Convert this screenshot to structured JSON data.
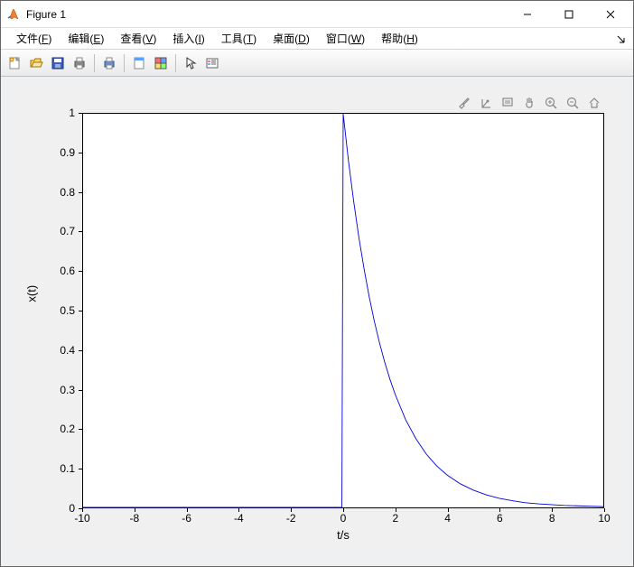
{
  "window": {
    "title": "Figure 1",
    "min_tip": "Minimize",
    "max_tip": "Maximize",
    "close_tip": "Close"
  },
  "menu": {
    "file": {
      "label": "文件",
      "hotkey": "F"
    },
    "edit": {
      "label": "编辑",
      "hotkey": "E"
    },
    "view": {
      "label": "查看",
      "hotkey": "V"
    },
    "insert": {
      "label": "插入",
      "hotkey": "I"
    },
    "tools": {
      "label": "工具",
      "hotkey": "T"
    },
    "desktop": {
      "label": "桌面",
      "hotkey": "D"
    },
    "windowm": {
      "label": "窗口",
      "hotkey": "W"
    },
    "help": {
      "label": "帮助",
      "hotkey": "H"
    }
  },
  "toolbar": {
    "new_tip": "New Figure",
    "open_tip": "Open",
    "save_tip": "Save",
    "print_tip": "Print",
    "printpreview_tip": "Print Preview",
    "link_tip": "Link Plot",
    "colorbar_tip": "Insert Colorbar",
    "arrow_tip": "Edit Plot",
    "legend_tip": "Insert Legend"
  },
  "axes_tools": {
    "brush": "Brush",
    "rotate": "Rotate 3D",
    "datatips": "Data Tips",
    "pan": "Pan",
    "zoomin": "Zoom In",
    "zoomout": "Zoom Out",
    "home": "Restore View"
  },
  "chart_data": {
    "type": "line",
    "xlabel": "t/s",
    "ylabel": "x(t)",
    "xlim": [
      -10,
      10
    ],
    "ylim": [
      0,
      1
    ],
    "xticks": [
      -10,
      -8,
      -6,
      -4,
      -2,
      0,
      2,
      4,
      6,
      8,
      10
    ],
    "yticks": [
      0,
      0.1,
      0.2,
      0.3,
      0.4,
      0.5,
      0.6,
      0.7,
      0.8,
      0.9,
      1
    ],
    "series": [
      {
        "name": "x(t)",
        "x": [
          -10,
          -8,
          -6,
          -4,
          -2,
          -0.05,
          0,
          0.2,
          0.4,
          0.6,
          0.8,
          1.0,
          1.2,
          1.4,
          1.6,
          1.8,
          2.0,
          2.4,
          2.8,
          3.2,
          3.6,
          4.0,
          4.5,
          5.0,
          5.5,
          6.0,
          6.5,
          7.0,
          7.5,
          8.0,
          8.5,
          9.0,
          9.5,
          10.0
        ],
        "y": [
          0,
          0,
          0,
          0,
          0,
          0,
          1,
          0.882,
          0.779,
          0.687,
          0.607,
          0.535,
          0.472,
          0.417,
          0.368,
          0.325,
          0.287,
          0.223,
          0.174,
          0.135,
          0.105,
          0.082,
          0.06,
          0.044,
          0.032,
          0.023,
          0.017,
          0.012,
          0.009,
          0.007,
          0.005,
          0.004,
          0.003,
          0.002
        ]
      }
    ]
  }
}
